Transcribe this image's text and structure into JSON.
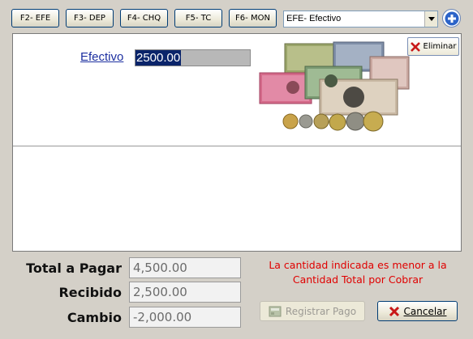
{
  "toolbar": {
    "buttons": [
      "F2- EFE",
      "F3- DEP",
      "F4- CHQ",
      "F5- TC",
      "F6- MON"
    ]
  },
  "payment_type_select": {
    "selected": "EFE- Efectivo"
  },
  "payment_line": {
    "method_label": "Efectivo",
    "amount": "2500.00",
    "delete_label": "Eliminar"
  },
  "summary": {
    "total_label": "Total a Pagar",
    "total_value": "4,500.00",
    "received_label": "Recibido",
    "received_value": "2,500.00",
    "change_label": "Cambio",
    "change_value": "-2,000.00"
  },
  "warning": {
    "line1": "La cantidad indicada es menor a la",
    "line2": "Cantidad Total por Cobrar"
  },
  "actions": {
    "register_label": "Registrar Pago",
    "cancel_label": "Cancelar"
  },
  "colors": {
    "window_bg": "#d4d0c8",
    "link": "#1c2fa0",
    "warning": "#e00000",
    "selection": "#0a246a"
  }
}
